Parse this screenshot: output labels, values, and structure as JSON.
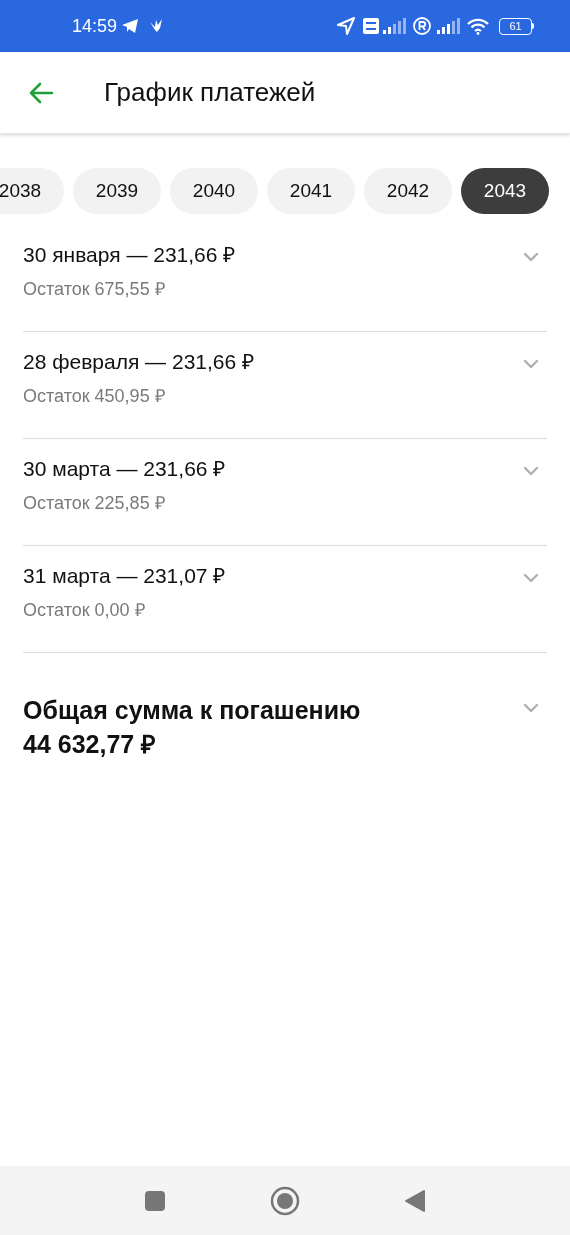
{
  "status_bar": {
    "time": "14:59",
    "battery": "61"
  },
  "header": {
    "title": "График платежей"
  },
  "years": [
    {
      "label": "2038",
      "selected": false
    },
    {
      "label": "2039",
      "selected": false
    },
    {
      "label": "2040",
      "selected": false
    },
    {
      "label": "2041",
      "selected": false
    },
    {
      "label": "2042",
      "selected": false
    },
    {
      "label": "2043",
      "selected": true
    }
  ],
  "payments": [
    {
      "title": "30 января — 231,66 ₽",
      "remainder": "Остаток 675,55 ₽",
      "expanded": false
    },
    {
      "title": "28 февраля — 231,66 ₽",
      "remainder": "Остаток 450,95 ₽",
      "expanded": false
    },
    {
      "title": "30 марта — 231,66 ₽",
      "remainder": "Остаток 225,85 ₽",
      "expanded": false
    },
    {
      "title": "31 марта — 231,07 ₽",
      "remainder": "Остаток 0,00 ₽",
      "expanded": false
    }
  ],
  "total": {
    "label": "Общая сумма к погашению",
    "amount": "44 632,77 ₽",
    "expanded": false
  }
}
